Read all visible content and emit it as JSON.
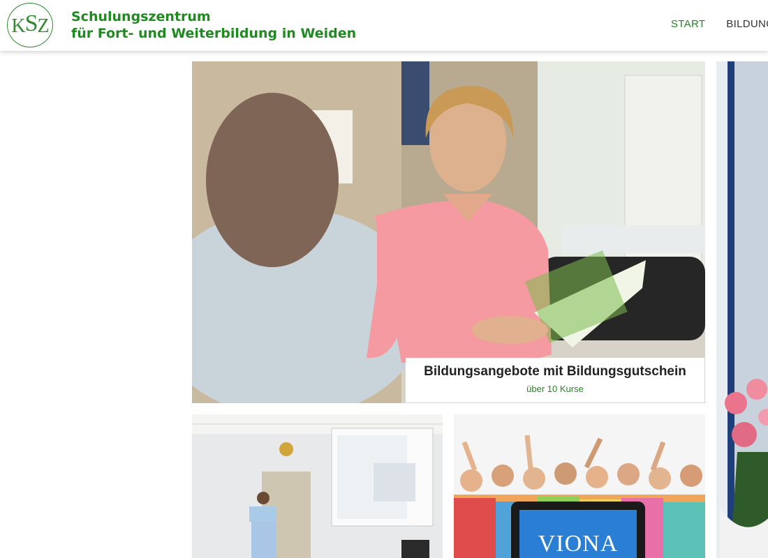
{
  "header": {
    "logo_text": "KSZ",
    "title_line1": "Schulungszentrum",
    "title_line2": "für Fort- und Weiterbildung in Weiden",
    "nav": [
      {
        "label": "START",
        "active": true
      },
      {
        "label": "BILDUNGSANGEBOTE",
        "active": false
      }
    ]
  },
  "hero": {
    "title": "Bildungsangebote mit Bildungsgutschein",
    "subtitle": "über 10 Kurse"
  },
  "tiles": {
    "viona_brand": "VIONA"
  },
  "colors": {
    "brand_green": "#1f8a1f",
    "shirt_pink": "#f59aa0"
  }
}
